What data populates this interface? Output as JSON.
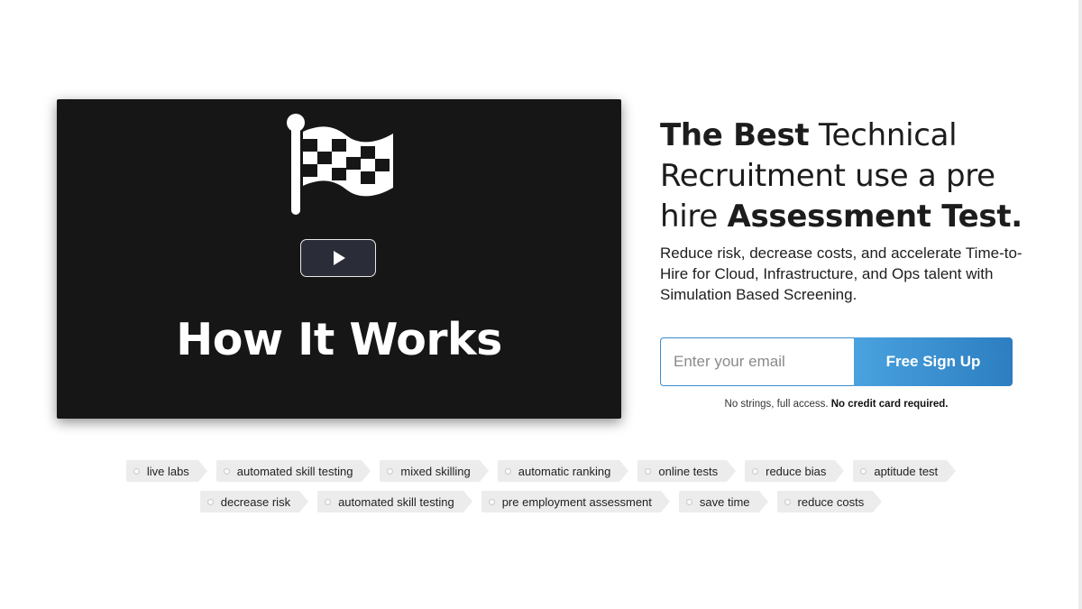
{
  "video": {
    "title": "How It Works",
    "flag_icon": "checkered-flag-icon",
    "play_icon": "play-icon"
  },
  "hero": {
    "headline": {
      "bold1": "The Best",
      "normal1": " Technical Recruitment use a pre hire ",
      "bold2": "Assessment Test."
    },
    "subtext": "Reduce risk, decrease costs, and accelerate Time-to-Hire for Cloud, Infrastructure, and Ops talent with Simulation Based Screening."
  },
  "signup": {
    "email_placeholder": "Enter your email",
    "email_value": "",
    "button_label": "Free Sign Up",
    "accent_color": "#3a8ccf",
    "fine_print": "No strings, full access. ",
    "fine_print_bold": "No credit card required."
  },
  "tags": {
    "row1": [
      "live labs",
      "automated skill testing",
      "mixed skilling",
      "automatic ranking",
      "online tests",
      "reduce bias",
      "aptitude test"
    ],
    "row2": [
      "decrease risk",
      "automated skill testing",
      "pre employment assessment",
      "save time",
      "reduce costs"
    ]
  }
}
